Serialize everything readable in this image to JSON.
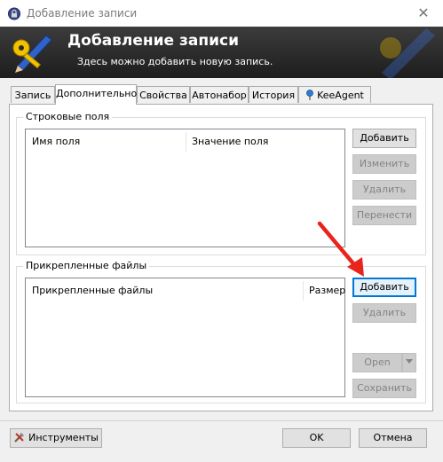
{
  "window": {
    "title": "Добавление записи",
    "close_glyph": "✕"
  },
  "banner": {
    "title": "Добавление записи",
    "subtitle": "Здесь можно добавить новую запись."
  },
  "tabs": [
    {
      "label": "Запись"
    },
    {
      "label": "Дополнительно",
      "active": true
    },
    {
      "label": "Свойства"
    },
    {
      "label": "Автонабор"
    },
    {
      "label": "История"
    },
    {
      "label": "KeeAgent",
      "icon": "keeagent-pin-icon"
    }
  ],
  "string_fields": {
    "group_label": "Строковые поля",
    "columns": [
      "Имя поля",
      "Значение поля"
    ],
    "buttons": {
      "add": "Добавить",
      "edit": "Изменить",
      "delete": "Удалить",
      "move": "Перенести"
    }
  },
  "attachments": {
    "group_label": "Прикрепленные файлы",
    "columns": [
      "Прикрепленные файлы",
      "Размер"
    ],
    "buttons": {
      "add": "Добавить",
      "delete": "Удалить",
      "open": "Open",
      "save": "Сохранить"
    }
  },
  "footer": {
    "tools": "Инструменты",
    "ok": "OK",
    "cancel": "Отмена"
  },
  "colors": {
    "annotation_arrow": "#e8241c",
    "focus_blue": "#0078d7",
    "banner_dark": "#2a2a2a"
  },
  "icons": [
    "lock-icon",
    "close-icon",
    "key-pen-icon",
    "keeagent-pin-icon",
    "tools-icon",
    "dropdown-arrow-icon",
    "red-arrow-annotation"
  ]
}
